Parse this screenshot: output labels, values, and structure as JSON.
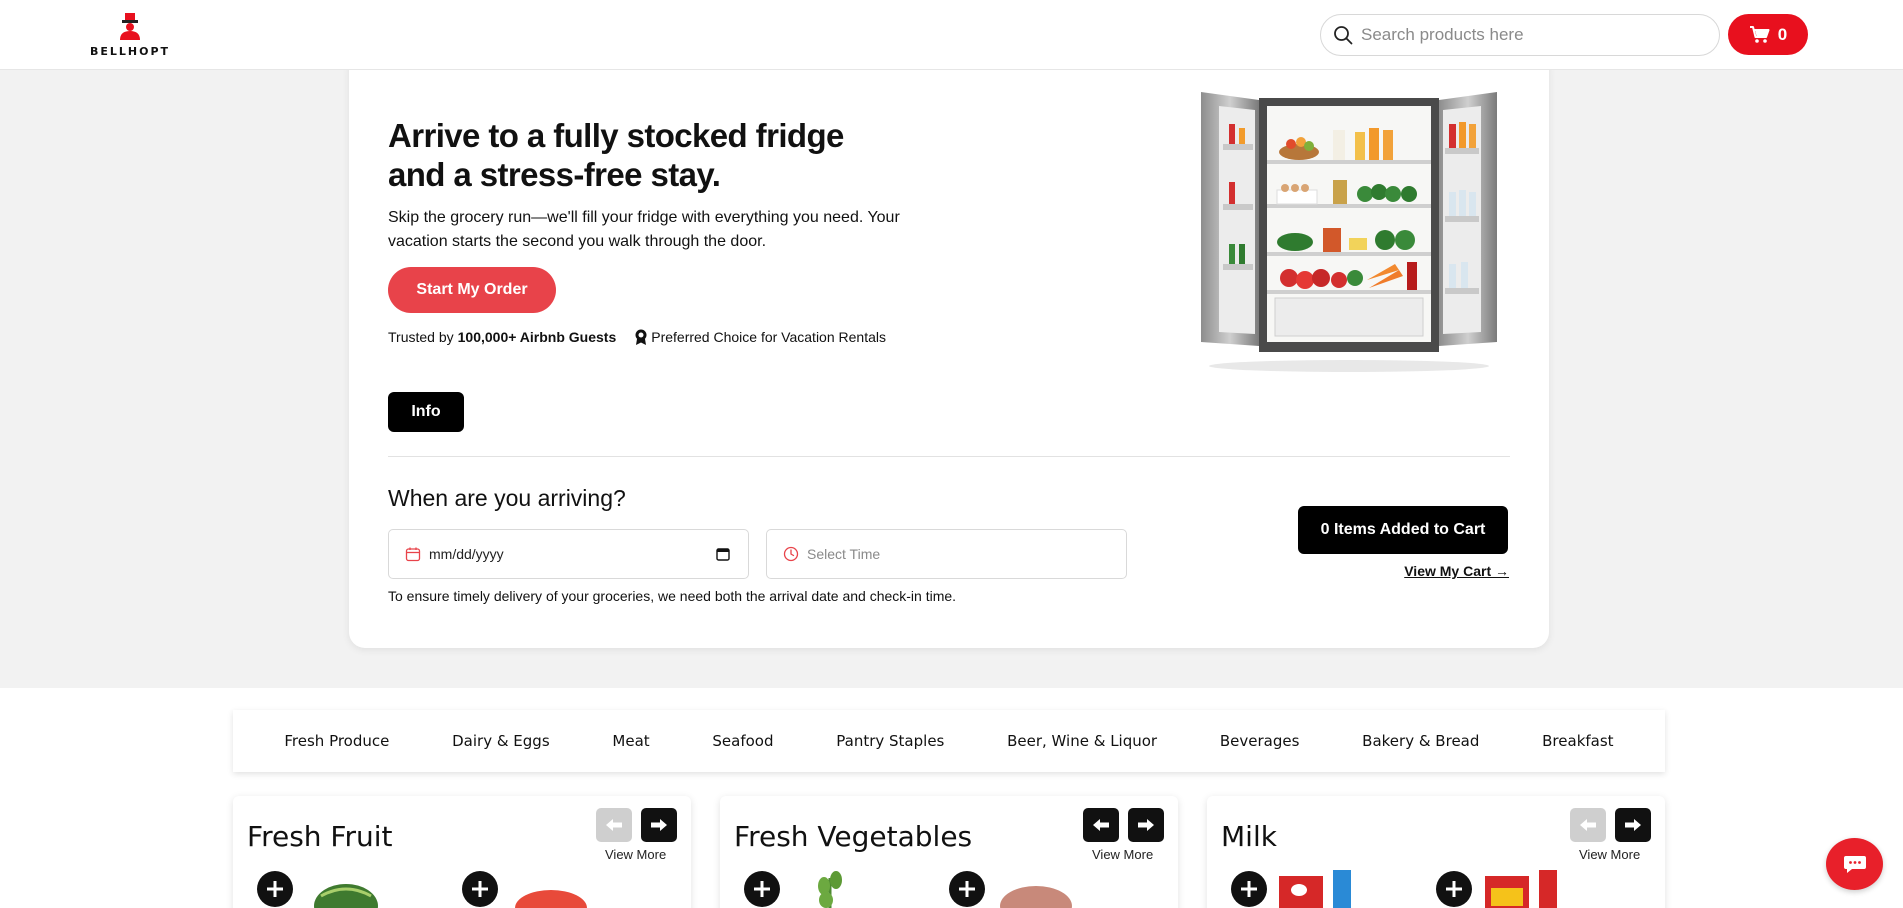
{
  "header": {
    "brand": "BELLHOPT",
    "search_placeholder": "Search products here",
    "cart_count": "0"
  },
  "hero": {
    "title": "Arrive to a fully stocked fridge and a stress-free stay.",
    "subtitle": "Skip the grocery run—we'll fill your fridge with everything you need. Your vacation starts the second you walk through the door.",
    "cta": "Start My Order",
    "trust_prefix": "Trusted by",
    "trust_bold": "100,000+ Airbnb Guests",
    "preferred": "Preferred Choice for Vacation Rentals",
    "info": "Info"
  },
  "arrival": {
    "title": "When are you arriving?",
    "date_placeholder": "mm/dd/yyyy",
    "time_placeholder": "Select Time",
    "hint": "To ensure timely delivery of your groceries, we need both the arrival date and check-in time.",
    "items_button": "0 Items Added to Cart",
    "view_cart": "View My Cart →"
  },
  "categories": [
    "Fresh Produce",
    "Dairy & Eggs",
    "Meat",
    "Seafood",
    "Pantry Staples",
    "Beer, Wine & Liquor",
    "Beverages",
    "Bakery & Bread",
    "Breakfast"
  ],
  "sections": [
    {
      "title": "Fresh Fruit",
      "view_more": "View More",
      "prev_enabled": false
    },
    {
      "title": "Fresh Vegetables",
      "view_more": "View More",
      "prev_enabled": true
    },
    {
      "title": "Milk",
      "view_more": "View More",
      "prev_enabled": false
    }
  ],
  "colors": {
    "accent": "#e8101e",
    "cta": "#e8434a",
    "dark": "#000000"
  }
}
